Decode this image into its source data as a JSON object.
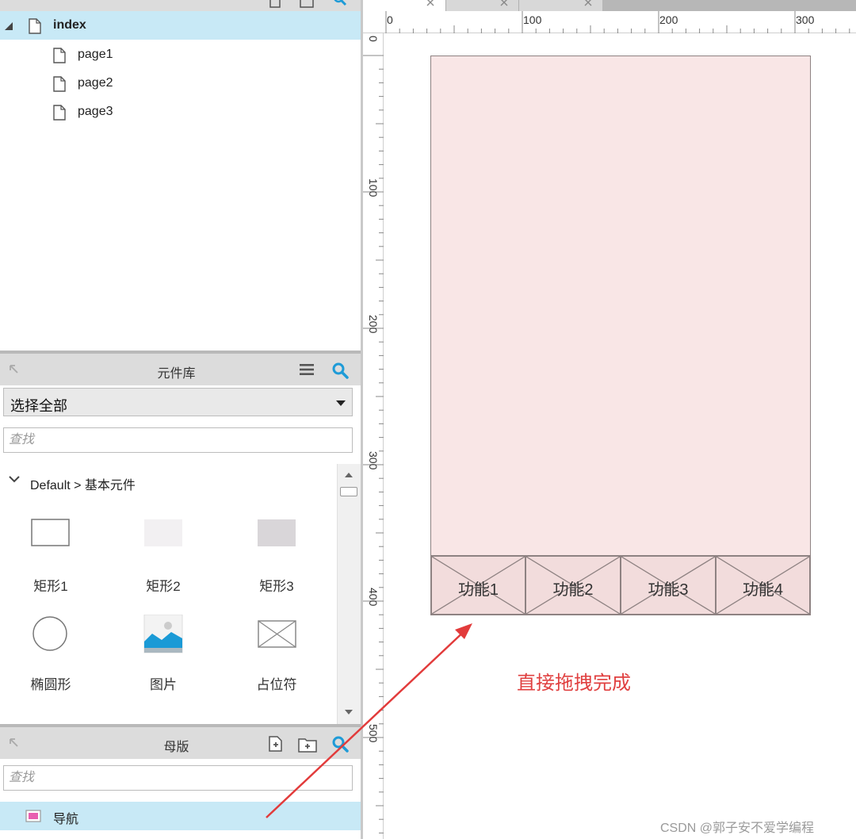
{
  "pages_panel": {
    "tree": [
      {
        "label": "index",
        "selected": true
      },
      {
        "label": "page1"
      },
      {
        "label": "page2"
      },
      {
        "label": "page3"
      }
    ]
  },
  "library_panel": {
    "title": "元件库",
    "selected_library": "选择全部",
    "search_placeholder": "查找",
    "group_label": "Default > 基本元件",
    "widgets": [
      {
        "label": "矩形1",
        "icon": "rectangle-outline-icon"
      },
      {
        "label": "矩形2",
        "icon": "rectangle-light-icon"
      },
      {
        "label": "矩形3",
        "icon": "rectangle-gray-icon"
      },
      {
        "label": "椭圆形",
        "icon": "ellipse-icon"
      },
      {
        "label": "图片",
        "icon": "image-icon"
      },
      {
        "label": "占位符",
        "icon": "placeholder-icon"
      }
    ]
  },
  "masters_panel": {
    "title": "母版",
    "search_placeholder": "查找",
    "items": [
      {
        "label": "导航",
        "selected": true
      }
    ]
  },
  "ruler": {
    "top_labels": [
      "0",
      "100",
      "200",
      "300"
    ],
    "left_labels": [
      "0",
      "100",
      "200",
      "300",
      "400",
      "500"
    ]
  },
  "canvas": {
    "nav_cells": [
      "功能1",
      "功能2",
      "功能3",
      "功能4"
    ],
    "annotation": "直接拖拽完成",
    "watermark": "CSDN @郭子安不爱学编程"
  },
  "colors": {
    "selection": "#c8e9f6",
    "accent_blue": "#1e9bd7",
    "page_fill": "#f9e6e6",
    "nav_fill": "#f2dcdc",
    "annotation_red": "#e04040"
  }
}
